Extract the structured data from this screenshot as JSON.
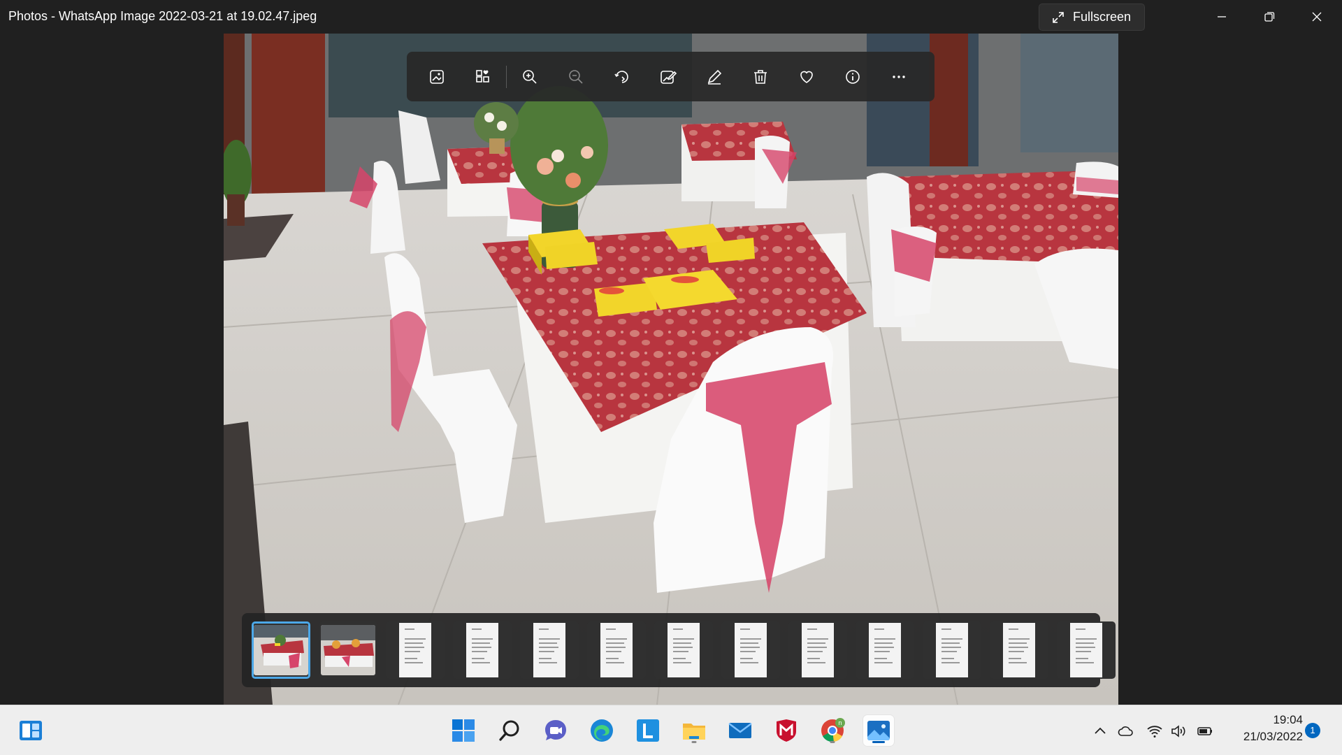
{
  "window": {
    "title": "Photos - WhatsApp Image 2022-03-21 at 19.02.47.jpeg",
    "fullscreen_label": "Fullscreen"
  },
  "toolbar": {
    "buttons": [
      {
        "icon": "view-actual-size-icon"
      },
      {
        "icon": "add-to-album-icon"
      },
      {
        "icon": "zoom-in-icon"
      },
      {
        "icon": "zoom-out-icon"
      },
      {
        "icon": "rotate-icon"
      },
      {
        "icon": "edit-image-icon"
      },
      {
        "icon": "draw-icon"
      },
      {
        "icon": "delete-icon"
      },
      {
        "icon": "favorite-icon"
      },
      {
        "icon": "info-icon"
      },
      {
        "icon": "more-icon"
      }
    ]
  },
  "filmstrip": {
    "selected_index": 0,
    "items": [
      "photo",
      "photo",
      "document",
      "document",
      "document",
      "document",
      "document",
      "document",
      "document",
      "document",
      "document",
      "document",
      "document"
    ]
  },
  "taskbar": {
    "apps": [
      "widgets-icon",
      "start-icon",
      "search-icon",
      "teams-chat-icon",
      "edge-icon",
      "l-app-icon",
      "file-explorer-icon",
      "mail-icon",
      "mcafee-icon",
      "chrome-icon",
      "photos-icon"
    ],
    "chrome_badge": "n",
    "clock": {
      "time": "19:04",
      "date": "21/03/2022"
    },
    "notification_count": "1"
  },
  "colors": {
    "accent": "#005fb8",
    "selection": "#4ca8e8",
    "tablecloth_red": "#b8353f",
    "sash_pink": "#d6456a",
    "box_yellow": "#f2d52a"
  }
}
